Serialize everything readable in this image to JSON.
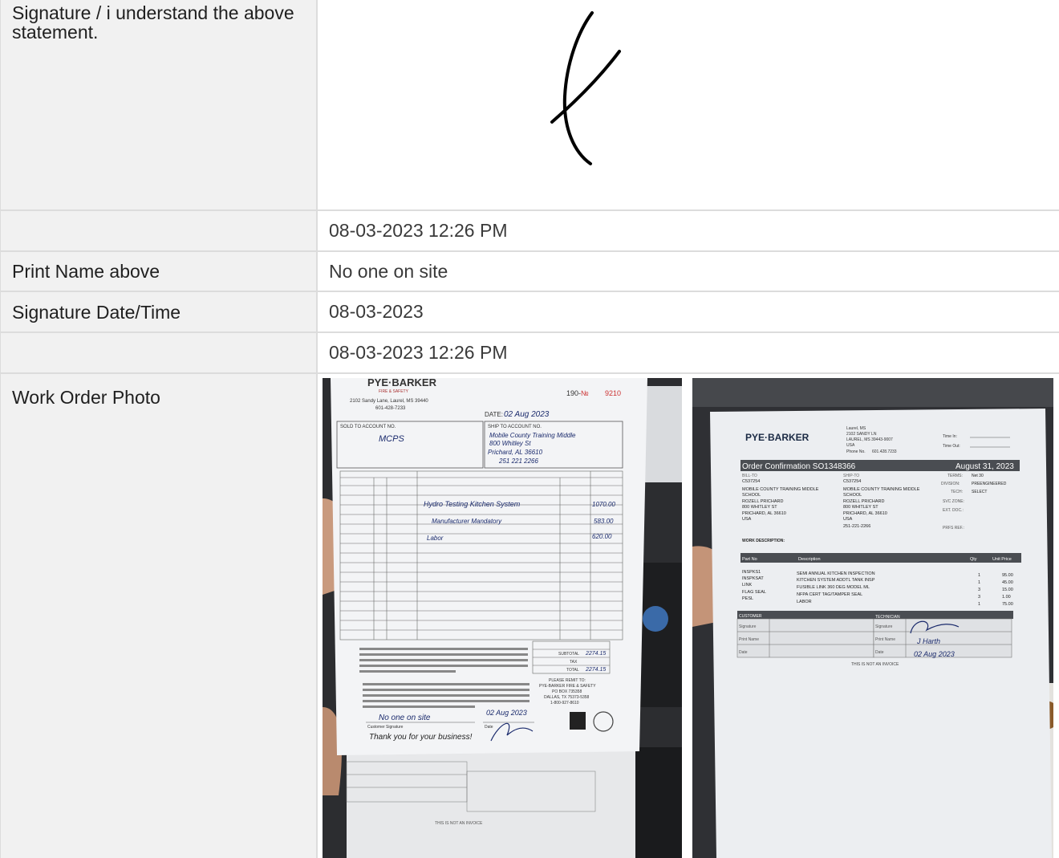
{
  "rows": [
    {
      "label": "Signature / i understand the above statement.",
      "value": ""
    },
    {
      "label": "",
      "value": "08-03-2023 12:26 PM"
    },
    {
      "label": "Print Name above",
      "value": "No one on site"
    },
    {
      "label": "Signature Date/Time",
      "value": "08-03-2023"
    },
    {
      "label": "",
      "value": "08-03-2023 12:26 PM"
    },
    {
      "label": "Work Order Photo",
      "value": ""
    }
  ],
  "photo1": {
    "company": "PYE·BARKER",
    "company_sub": "FIRE & SAFETY",
    "address": "2102 Sandy Lane, Laurel, MS 39440",
    "phone": "601-428-7233",
    "order_prefix": "190-",
    "order_no_label": "№",
    "order_no": "9210",
    "date_label": "DATE:",
    "date_value": "02 Aug 2023",
    "sold_to_label": "SOLD TO ACCOUNT NO.",
    "sold_to_value": "MCPS",
    "ship_to_label": "SHIP TO ACCOUNT NO.",
    "ship_to_lines": [
      "Mobile County Training Middle",
      "800 Whitley St",
      "Prichard, AL 36610",
      "251 221 2266"
    ],
    "items": [
      "Hydro Testing Kitchen System",
      "Manufacturer Mandatory",
      "Labor"
    ],
    "amounts": [
      "1070.00",
      "583.00",
      "620.00"
    ],
    "subtotal_label": "SUBTOTAL",
    "subtotal": "2274.15",
    "tax_label": "TAX",
    "total_label": "TOTAL",
    "total": "2274.15",
    "remit": [
      "PLEASE REMIT TO:",
      "PYE-BARKER FIRE & SAFETY",
      "PO BOX 735358",
      "DALLAS, TX 75373-5358",
      "1-800-927-8610"
    ],
    "customer_sig_label": "Customer Signature",
    "customer_sig_value": "No one on site",
    "date_sig_label": "Date",
    "date_sig_value": "02 Aug 2023",
    "thanks": "Thank you for your business!",
    "footer": "THIS IS NOT AN INVOICE"
  },
  "photo2": {
    "company": "PYE·BARKER",
    "address_lines": [
      "Laurel, MS",
      "2102 SANDY LN",
      "LAUREL, MS 39443-9007",
      "USA"
    ],
    "phone_label": "Phone No.",
    "phone": "601.428.7233",
    "time_in_label": "Time In:",
    "time_out_label": "Time Out:",
    "title": "Order Confirmation SO1348366",
    "date": "August 31, 2023",
    "bill_to_label": "BILL-TO",
    "bill_to": [
      "C537254",
      "MOBILE COUNTY TRAINING MIDDLE",
      "SCHOOL",
      "ROZELL PRICHARD",
      "800 WHITLEY ST",
      "PRICHARD, AL 36610",
      "USA"
    ],
    "ship_to_label": "SHIP-TO",
    "ship_to": [
      "C537254",
      "MOBILE COUNTY TRAINING MIDDLE",
      "SCHOOL",
      "ROZELL PRICHARD",
      "800 WHITLEY ST",
      "PRICHARD, AL 36610",
      "USA",
      "251-221-2266"
    ],
    "terms_label": "TERMS:",
    "terms": "Net 30",
    "division_label": "DIVISION:",
    "division": "PREENGINEERED",
    "tech_label": "TECH:",
    "tech": "SELECT",
    "svc_zone_label": "SVC ZONE:",
    "ext_doc_label": "EXT. DOC.:",
    "prfs_ref_label": "PRFS REF.:",
    "work_desc_label": "WORK DESCRIPTION:",
    "col_part": "Part No",
    "col_desc": "Description",
    "col_qty": "Qty",
    "col_price": "Unit Price",
    "lines": [
      {
        "part": "INSPKS1",
        "desc": "SEMI ANNUAL KITCHEN INSPECTION",
        "qty": "1",
        "price": "95.00"
      },
      {
        "part": "INSPKSAT",
        "desc": "KITCHEN SYSTEM ADDTL TANK INSP",
        "qty": "1",
        "price": "45.00"
      },
      {
        "part": "LINK",
        "desc": "FUSIBLE LINK 360 DEG MODEL ML",
        "qty": "3",
        "price": "15.00"
      },
      {
        "part": "FLAG SEAL",
        "desc": "NFPA CERT TAG/TAMPER SEAL",
        "qty": "3",
        "price": "1.00"
      },
      {
        "part": "PESL",
        "desc": "LABOR",
        "qty": "1",
        "price": "75.00"
      }
    ],
    "customer_label": "CUSTOMER",
    "technician_label": "TECHNICIAN",
    "signature_label": "Signature",
    "print_name_label": "Print Name",
    "date_label": "Date",
    "tech_name": "J Harth",
    "tech_date": "02 Aug 2023",
    "footer": "THIS IS NOT AN INVOICE"
  }
}
